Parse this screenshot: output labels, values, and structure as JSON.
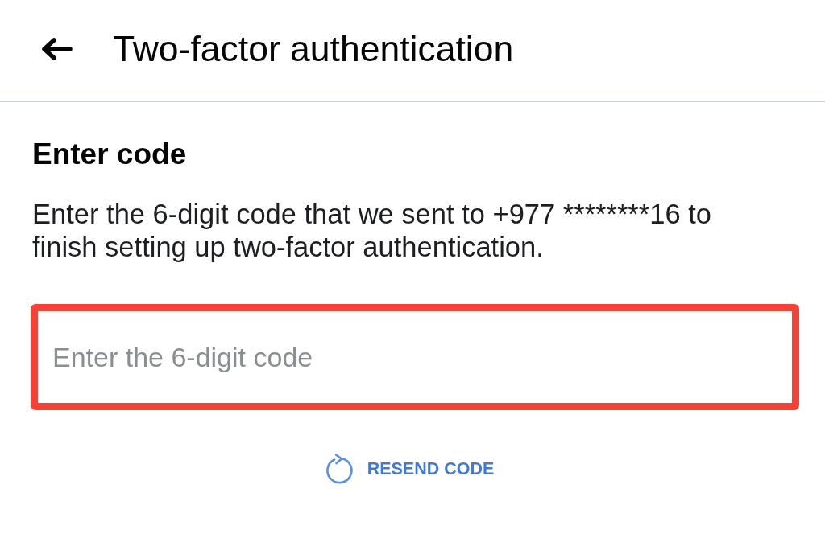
{
  "header": {
    "title": "Two-factor authentication"
  },
  "content": {
    "heading": "Enter code",
    "description": "Enter the 6-digit code that we sent to +977 ********16 to finish setting up two-factor authentication.",
    "code_field": {
      "placeholder": "Enter the 6-digit code",
      "highlighted": true
    },
    "resend": {
      "label": "RESEND CODE"
    }
  }
}
